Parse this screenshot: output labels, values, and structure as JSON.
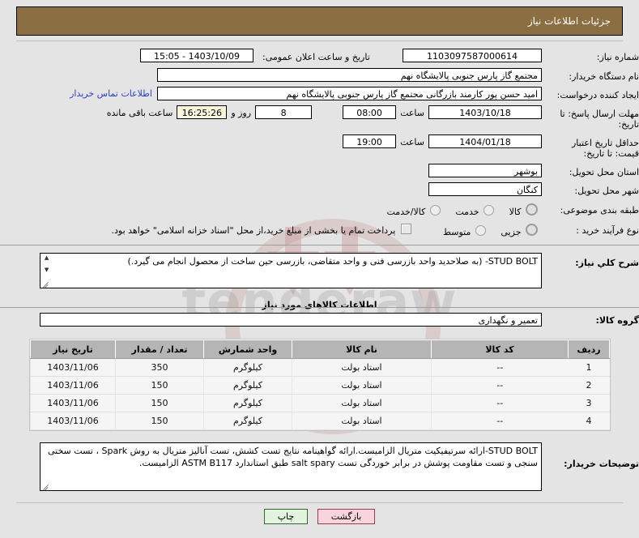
{
  "header": {
    "title": "جزئیات اطلاعات نیاز",
    "bar_color": "#8B6F43"
  },
  "fields": {
    "need_number_label": "شماره نیاز:",
    "need_number_value": "1103097587000614",
    "announce_label": "تاریخ و ساعت اعلان عمومی:",
    "announce_value": "1403/10/09 - 15:05",
    "buyer_org_label": "نام دستگاه خریدار:",
    "buyer_org_value": "مجتمع گاز پارس جنوبی  پالایشگاه نهم",
    "requester_label": "ایجاد کننده درخواست:",
    "requester_value": "امید حسن پور کارمند بازرگانی مجتمع گاز پارس جنوبی  پالایشگاه نهم",
    "contact_link": "اطلاعات تماس خریدار",
    "reply_deadline_label": "مهلت ارسال پاسخ: تا تاریخ:",
    "reply_deadline_date": "1403/10/18",
    "hour_label": "ساعت",
    "reply_deadline_time": "08:00",
    "days_remaining": "8",
    "days_word": "روز و",
    "time_remaining": "16:25:26",
    "remaining_suffix": "ساعت باقی مانده",
    "price_validity_label": "حداقل تاریخ اعتبار قیمت: تا تاریخ:",
    "price_validity_date": "1404/01/18",
    "price_validity_time": "19:00",
    "province_label": "استان محل تحویل:",
    "province_value": "بوشهر",
    "city_label": "شهر محل تحویل:",
    "city_value": "کنگان",
    "category_label": "طبقه بندی موضوعی:",
    "process_label": "نوع فرآیند خرید :",
    "desc_label": "شرح کلي نياز:",
    "desc_value": "STUD BOLT- (به صلاحدید واحد بازرسی فنی  و واحد متقاضی، بازرسی حین ساخت از محصول انجام می گیرد.)",
    "goods_group_label": "گروه کالا:",
    "goods_group_value": "تعمیر و نگهداری",
    "notes_label": "توضیحات خریدار:",
    "notes_value": "STUD BOLT-ارائه سرتیفیکیت متریال الزامیست.ارائه گواهینامه نتایج تست کشش، تست آنالیز متریال به روش Spark ، تست سختی سنجی و تست مقاومت پوشش در برابر خوردگی تست salt spary طبق استاندارد  ASTM B117 الزامیست."
  },
  "category_options": [
    {
      "label": "کالا",
      "selected": true
    },
    {
      "label": "خدمت",
      "selected": false
    },
    {
      "label": "کالا/خدمت",
      "selected": false
    }
  ],
  "process_options": [
    {
      "label": "جزیی",
      "selected": true
    },
    {
      "label": "متوسط",
      "selected": false
    }
  ],
  "treasury": {
    "checked": false,
    "text": "پرداخت تمام یا بخشی از مبلغ خرید،از محل \"اسناد خزانه اسلامی\" خواهد بود."
  },
  "section_heading": "اطلاعات کالاهای مورد نیاز",
  "table": {
    "columns": [
      "ردیف",
      "کد کالا",
      "نام کالا",
      "واحد شمارش",
      "تعداد / مقدار",
      "تاریخ نیاز"
    ],
    "rows": [
      {
        "no": "1",
        "code": "--",
        "name": "استاد بولت",
        "unit": "کیلوگرم",
        "qty": "350",
        "date": "1403/11/06"
      },
      {
        "no": "2",
        "code": "--",
        "name": "استاد بولت",
        "unit": "کیلوگرم",
        "qty": "150",
        "date": "1403/11/06"
      },
      {
        "no": "3",
        "code": "--",
        "name": "استاد بولت",
        "unit": "کیلوگرم",
        "qty": "150",
        "date": "1403/11/06"
      },
      {
        "no": "4",
        "code": "--",
        "name": "استاد بولت",
        "unit": "کیلوگرم",
        "qty": "150",
        "date": "1403/11/06"
      }
    ]
  },
  "buttons": {
    "print": "چاپ",
    "back": "بازگشت"
  },
  "watermark": {
    "text": "tenderaw"
  }
}
